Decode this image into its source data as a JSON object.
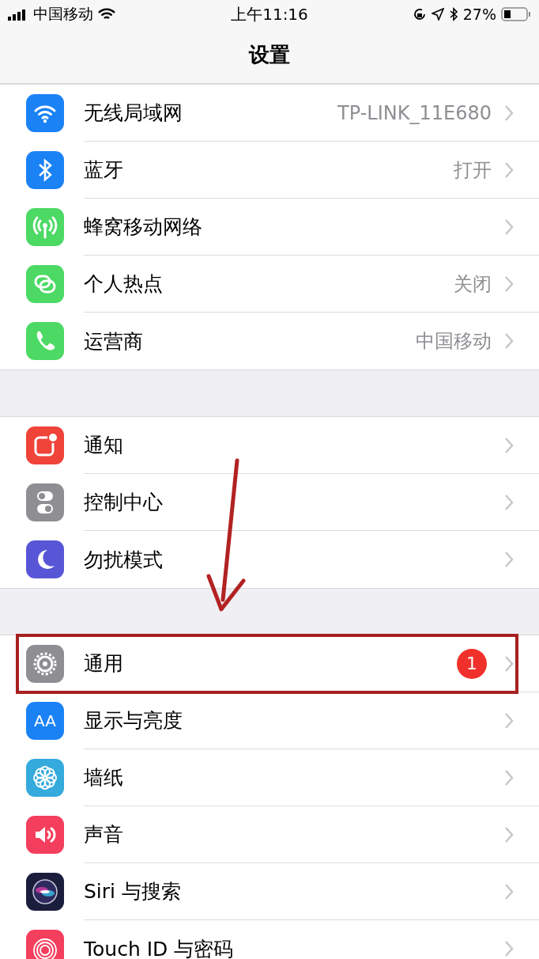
{
  "status_bar": {
    "carrier": "中国移动",
    "time": "上午11:16",
    "battery": "27%"
  },
  "nav": {
    "title": "设置"
  },
  "sections": [
    {
      "rows": [
        {
          "label": "无线局域网",
          "value": "TP-LINK_11E680"
        },
        {
          "label": "蓝牙",
          "value": "打开"
        },
        {
          "label": "蜂窝移动网络"
        },
        {
          "label": "个人热点",
          "value": "关闭"
        },
        {
          "label": "运营商",
          "value": "中国移动"
        }
      ]
    },
    {
      "rows": [
        {
          "label": "通知"
        },
        {
          "label": "控制中心"
        },
        {
          "label": "勿扰模式"
        }
      ]
    },
    {
      "rows": [
        {
          "label": "通用",
          "badge": "1",
          "highlighted": true
        },
        {
          "label": "显示与亮度",
          "icon_text": "AA",
          "highlighted": false
        },
        {
          "label": "墙纸",
          "highlighted": false
        },
        {
          "label": "声音",
          "highlighted": false
        },
        {
          "label": "Siri 与搜索",
          "highlighted": false
        },
        {
          "label": "Touch ID 与密码",
          "highlighted": false
        }
      ]
    }
  ]
}
